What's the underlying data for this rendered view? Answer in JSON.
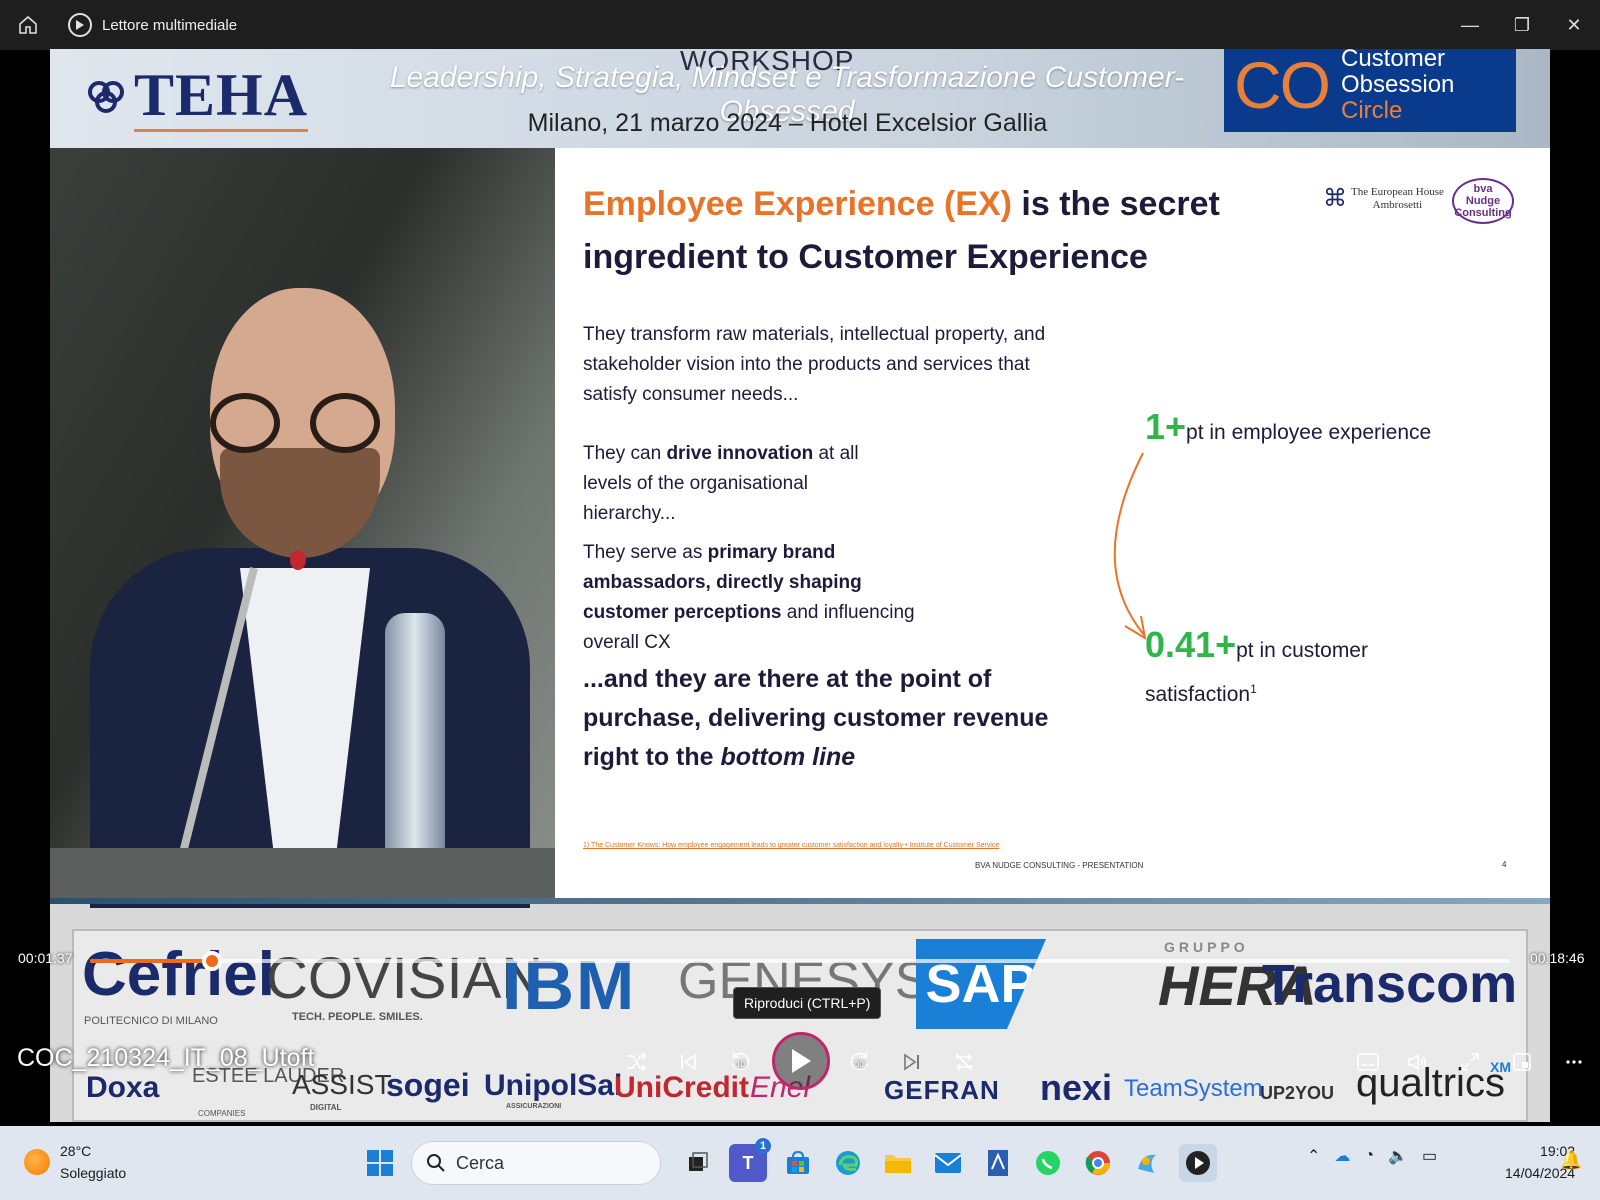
{
  "window": {
    "app_title": "Lettore multimediale",
    "minimize": "—",
    "restore": "❐",
    "close": "✕"
  },
  "banner": {
    "workshop": "WORKSHOP",
    "subtitle": "Leadership, Strategia, Mindset e Trasformazione Customer-Obsessed",
    "location": "Milano, 21 marzo 2024 – Hotel Excelsior Gallia",
    "teha_logo": "TEHA",
    "co_mark": "CO",
    "co_line1": "Customer Obsession",
    "co_line2": "Circle"
  },
  "slide": {
    "title_highlight": "Employee Experience (EX)",
    "title_rest": " is the secret ingredient to Customer Experience",
    "logo_teh_line1": "The European House",
    "logo_teh_line2": "Ambrosetti",
    "logo_bva_line1": "bva",
    "logo_bva_line2": "Nudge",
    "logo_bva_line3": "Consulting",
    "para1": "They transform raw materials, intellectual property, and stakeholder vision into the products and services that satisfy consumer needs...",
    "para2_a": "They can ",
    "para2_b": "drive innovation",
    "para2_c": " at all levels of the organisational hierarchy...",
    "para3_a": "They serve as ",
    "para3_b": "primary brand ambassadors, directly shaping customer perceptions",
    "para3_c": " and influencing overall CX",
    "closing_a": "...and they are there at the point of purchase, delivering customer revenue right to the ",
    "closing_b": "bottom line",
    "stat1_value": "1+",
    "stat1_label": "pt in employee experience",
    "stat2_value": "0.41+",
    "stat2_label_a": "pt in customer",
    "stat2_label_b": "satisfaction",
    "stat2_sup": "1",
    "footnote": "1) The Customer Knows: How employee engagement leads to greater customer satisfaction and loyalty • Institute of Customer Service",
    "footer_center": "BVA NUDGE CONSULTING - PRESENTATION",
    "page_number": "4"
  },
  "sponsors": {
    "row1": [
      "Cefriel",
      "POLITECNICO DI MILANO",
      "COVISIAN",
      "TECH. PEOPLE. SMILES.",
      "IBM",
      "GENESYS",
      "SAP",
      "GRUPPO",
      "HERA",
      "Transcom"
    ],
    "row2": [
      "Doxa",
      "ESTEE LAUDER",
      "COMPANIES",
      "ASSIST",
      "DIGITAL",
      "sogei",
      "UnipolSai",
      "ASSICURAZIONI",
      "UniCredit",
      "Enel",
      "GEFRAN",
      "nexi",
      "TeamSystem",
      "UP2YOU",
      "qualtrics",
      "XM"
    ]
  },
  "player": {
    "current_time": "00:01:37",
    "total_time": "00:18:46",
    "progress_fraction": 0.086,
    "media_title": "COC_210324_IT_08_Utoft",
    "tooltip": "Riproduci (CTRL+P)",
    "rewind_label": "10",
    "forward_label": "30",
    "accent_color": "#f06a1a"
  },
  "taskbar": {
    "temperature": "28°C",
    "weather": "Soleggiato",
    "search_placeholder": "Cerca",
    "teams_badge": "1",
    "time": "19:02",
    "date": "14/04/2024"
  }
}
